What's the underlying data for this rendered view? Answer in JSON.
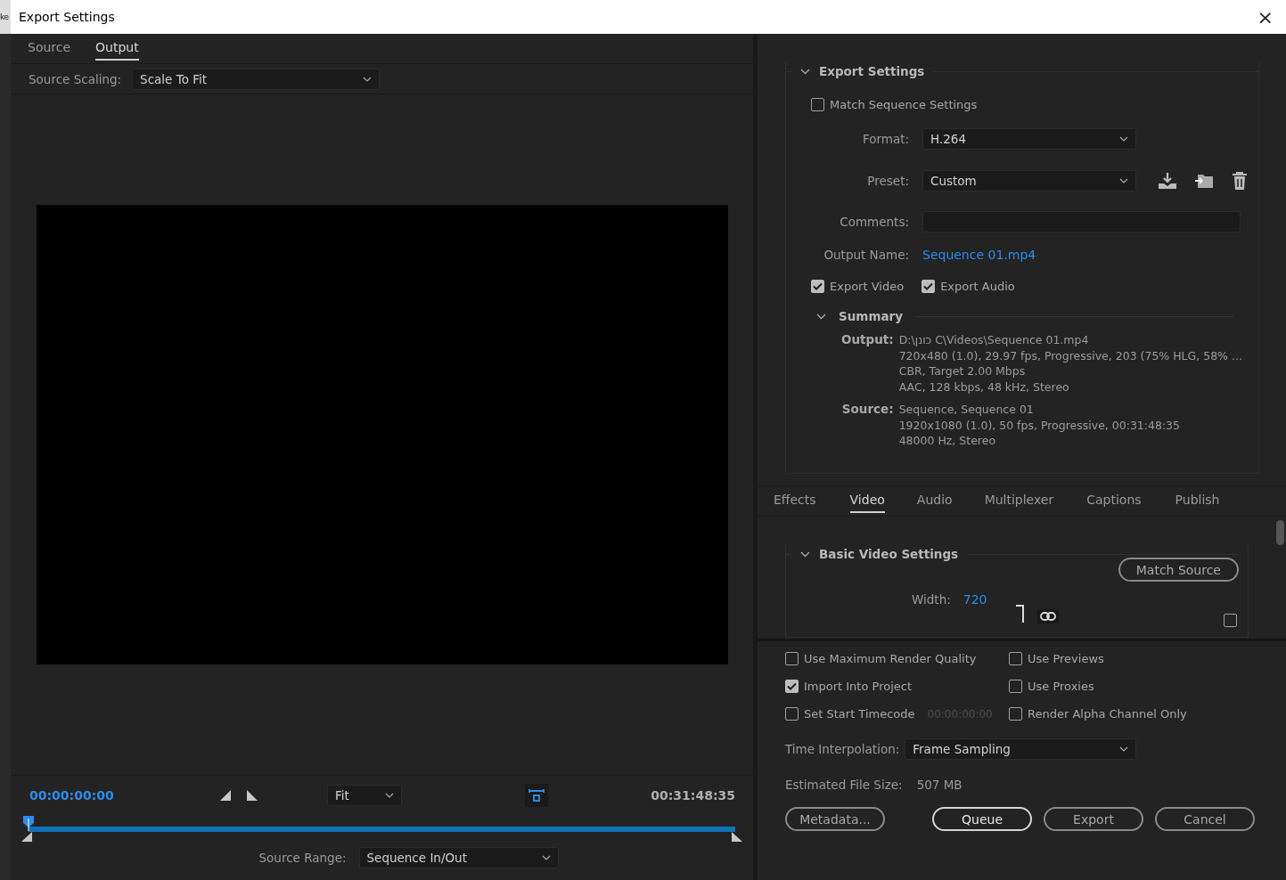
{
  "background_app": {
    "fragment": "ke"
  },
  "window": {
    "title": "Export Settings",
    "close": "×"
  },
  "left_tabs": [
    {
      "label": "Source",
      "selected": false
    },
    {
      "label": "Output",
      "selected": true
    }
  ],
  "source_scaling": {
    "label": "Source Scaling:",
    "value": "Scale To Fit"
  },
  "timeline": {
    "current": "00:00:00:00",
    "zoom": "Fit",
    "duration": "00:31:48:35",
    "level": 0,
    "range_label": "Source Range:",
    "range_value": "Sequence In/Out"
  },
  "export_settings": {
    "title": "Export Settings",
    "expanded": true,
    "match_sequence": {
      "label": "Match Sequence Settings",
      "checked": false
    },
    "format": {
      "label": "Format:",
      "value": "H.264"
    },
    "preset": {
      "label": "Preset:",
      "value": "Custom"
    },
    "comments": {
      "label": "Comments:"
    },
    "output_name": {
      "label": "Output Name:",
      "value": "Sequence 01.mp4"
    },
    "export_checks": [
      {
        "label": "Export Video",
        "checked": true
      },
      {
        "label": "Export Audio",
        "checked": true
      }
    ],
    "summary": {
      "title": "Summary",
      "expanded": true,
      "groups": [
        {
          "label": "Output:",
          "lines": [
            "D:\\כונן C\\Videos\\Sequence 01.mp4",
            "720x480 (1.0), 29.97 fps, Progressive, 203 (75% HLG, 58% ...",
            "CBR, Target 2.00 Mbps",
            "AAC, 128 kbps, 48 kHz, Stereo"
          ]
        },
        {
          "label": "Source:",
          "lines": [
            "Sequence, Sequence 01",
            "1920x1080 (1.0), 50 fps, Progressive, 00:31:48:35",
            "48000 Hz, Stereo"
          ]
        }
      ]
    }
  },
  "settings_tabs": [
    {
      "label": "Effects",
      "selected": false
    },
    {
      "label": "Video",
      "selected": true
    },
    {
      "label": "Audio",
      "selected": false
    },
    {
      "label": "Multiplexer",
      "selected": false
    },
    {
      "label": "Captions",
      "selected": false
    },
    {
      "label": "Publish",
      "selected": false
    }
  ],
  "basic_video": {
    "title": "Basic Video Settings",
    "expanded": true,
    "button": "Match Source",
    "width_label": "Width:",
    "width_value": "720",
    "aspect_checked": false
  },
  "options": [
    {
      "label": "Use Maximum Render Quality",
      "checked": false
    },
    {
      "label": "Use Previews",
      "checked": false
    },
    {
      "label": "Import Into Project",
      "checked": true
    },
    {
      "label": "Use Proxies",
      "checked": false
    },
    {
      "label": "Set Start Timecode",
      "checked": false,
      "timecode": "00:00:00:00"
    },
    {
      "label": "Render Alpha Channel Only",
      "checked": false
    }
  ],
  "time_interpolation": {
    "label": "Time Interpolation:",
    "value": "Frame Sampling"
  },
  "file_size": {
    "label": "Estimated File Size:",
    "value": "507 MB"
  },
  "buttons": [
    {
      "label": "Metadata...",
      "kind": "secondary"
    },
    {
      "label": "Queue",
      "kind": "primary"
    },
    {
      "label": "Export",
      "kind": "secondary"
    },
    {
      "label": "Cancel",
      "kind": "secondary"
    }
  ]
}
